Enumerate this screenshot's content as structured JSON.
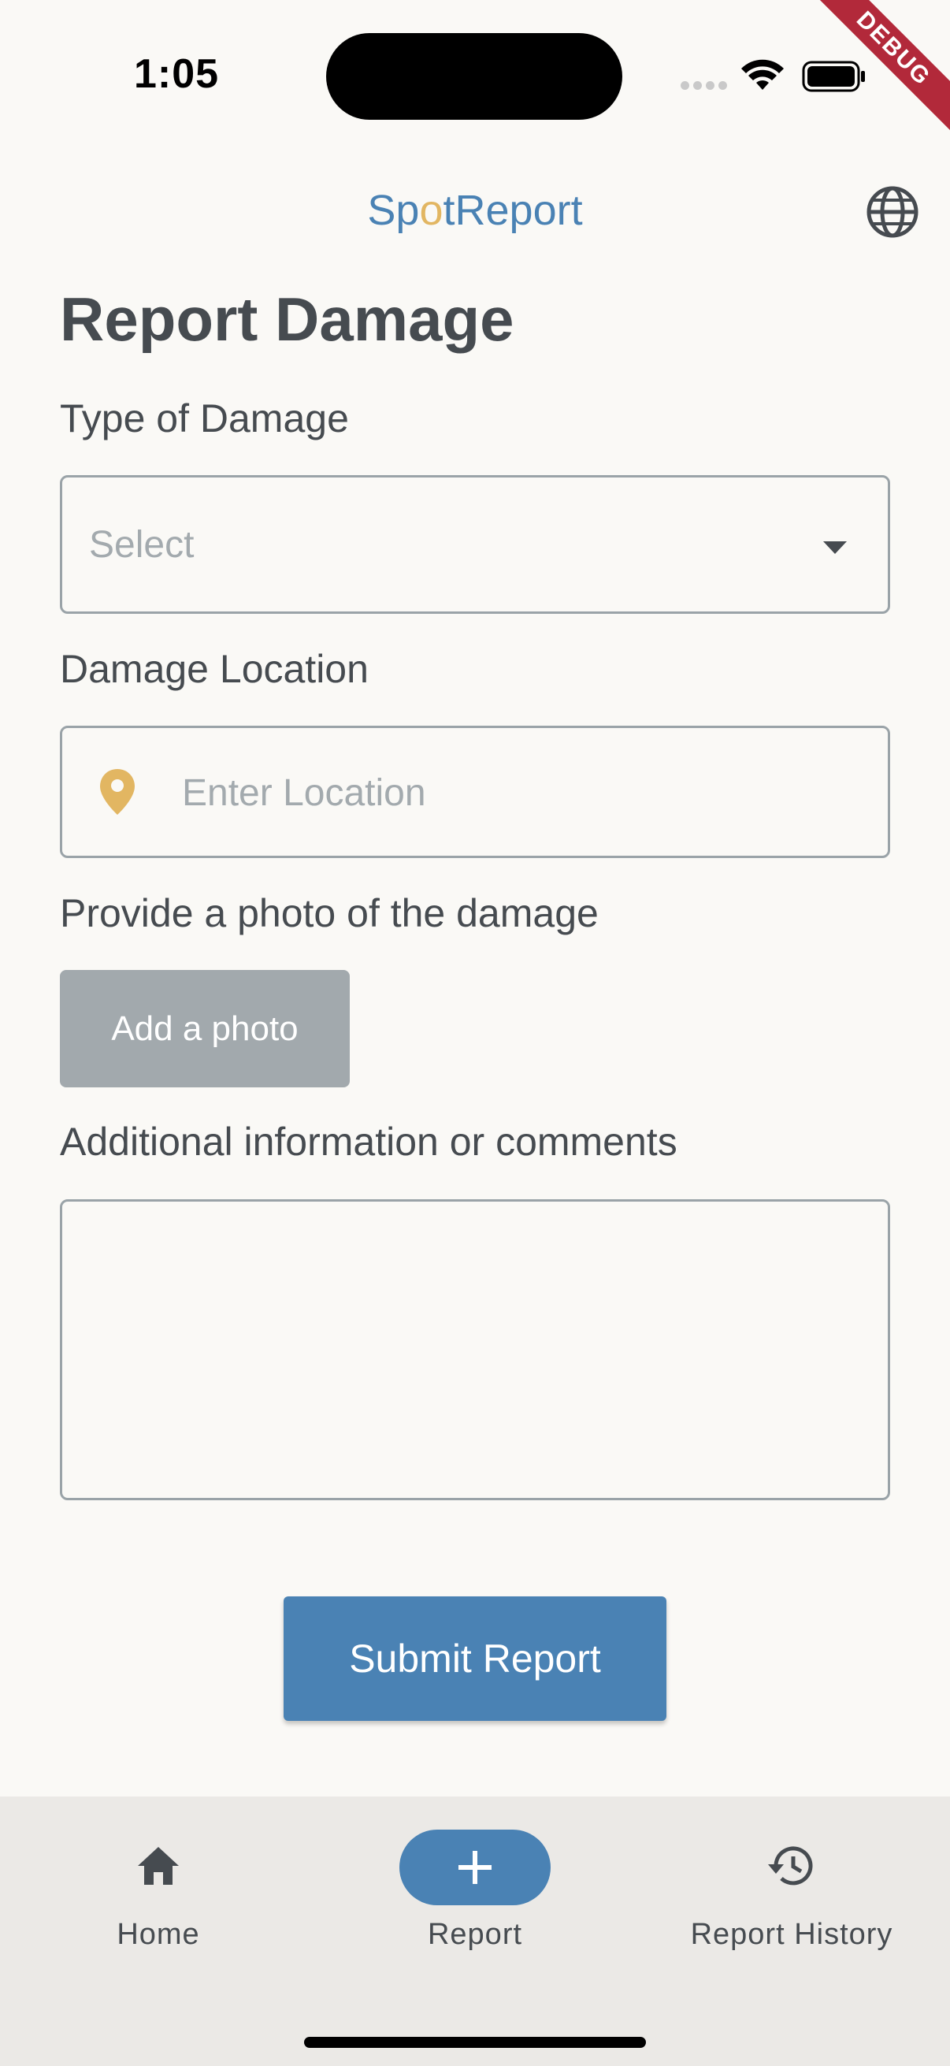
{
  "status_bar": {
    "time": "1:05",
    "debug_label": "DEBUG",
    "icons": [
      "cellular-signal-icon",
      "wifi-icon",
      "battery-icon"
    ]
  },
  "app_bar": {
    "title_parts": [
      "Sp",
      "o",
      "tReport"
    ],
    "title_colors": {
      "primary": "#4a82b4",
      "accent": "#e2b662"
    },
    "language_icon": "globe-icon"
  },
  "form": {
    "title": "Report Damage",
    "damage_type": {
      "label": "Type of Damage",
      "placeholder": "Select"
    },
    "location": {
      "label": "Damage Location",
      "placeholder": "Enter Location",
      "value": "",
      "icon": "location-pin-icon"
    },
    "photo": {
      "label": "Provide a photo of the damage",
      "button": "Add a photo"
    },
    "comments": {
      "label": "Additional information or comments",
      "value": ""
    },
    "submit": "Submit Report"
  },
  "bottom_nav": {
    "items": [
      {
        "label": "Home",
        "icon": "home-icon",
        "active": false
      },
      {
        "label": "Report",
        "icon": "plus-icon",
        "active": true
      },
      {
        "label": "Report History",
        "icon": "history-icon",
        "active": false
      }
    ]
  },
  "colors": {
    "background": "#faf9f6",
    "primary": "#4a82b4",
    "pin": "#e2b662",
    "disabled_button": "#a2a9ad",
    "nav_background": "#ebe9e6"
  }
}
